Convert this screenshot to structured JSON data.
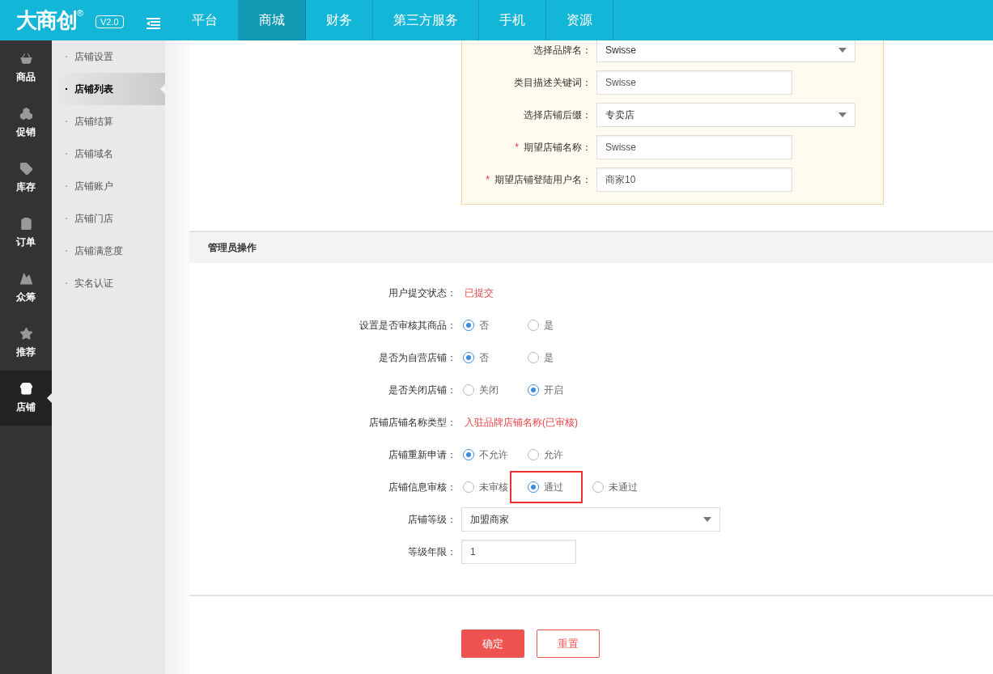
{
  "header": {
    "logo": "大商创",
    "registered": "®",
    "version": "V2.0",
    "nav": [
      {
        "label": "平台",
        "selected": false
      },
      {
        "label": "商城",
        "selected": true
      },
      {
        "label": "财务",
        "selected": false
      },
      {
        "label": "第三方服务",
        "selected": false
      },
      {
        "label": "手机",
        "selected": false
      },
      {
        "label": "资源",
        "selected": false
      }
    ]
  },
  "sidebar": {
    "items": [
      {
        "label": "商品",
        "selected": false
      },
      {
        "label": "促销",
        "selected": false
      },
      {
        "label": "库存",
        "selected": false
      },
      {
        "label": "订单",
        "selected": false
      },
      {
        "label": "众筹",
        "selected": false
      },
      {
        "label": "推荐",
        "selected": false
      },
      {
        "label": "店铺",
        "selected": true
      }
    ]
  },
  "submenu": {
    "items": [
      {
        "label": "店铺设置",
        "selected": false
      },
      {
        "label": "店铺列表",
        "selected": true
      },
      {
        "label": "店铺结算",
        "selected": false
      },
      {
        "label": "店铺域名",
        "selected": false
      },
      {
        "label": "店铺账户",
        "selected": false
      },
      {
        "label": "店铺门店",
        "selected": false
      },
      {
        "label": "店铺满意度",
        "selected": false
      },
      {
        "label": "实名认证",
        "selected": false
      }
    ]
  },
  "brand_form": {
    "fields": [
      {
        "kind": "select",
        "label": "选择品牌名：",
        "value": "Swisse"
      },
      {
        "kind": "input",
        "label": "类目描述关键词：",
        "value": "Swisse"
      },
      {
        "kind": "select",
        "label": "选择店铺后缀：",
        "value": "专卖店"
      },
      {
        "kind": "input",
        "label": "期望店铺名称：",
        "value": "Swisse",
        "mark": "*"
      },
      {
        "kind": "input",
        "label": "期望店铺登陆用户名：",
        "value": "商家10",
        "mark": "*"
      }
    ]
  },
  "admin": {
    "title": "管理员操作",
    "rows": [
      {
        "kind": "text",
        "label": "用户提交状态：",
        "value": "已提交"
      },
      {
        "kind": "radio",
        "label": "设置是否审核其商品：",
        "options": [
          {
            "label": "否",
            "selected": true,
            "highlighted": false
          },
          {
            "label": "是",
            "selected": false,
            "highlighted": false
          }
        ]
      },
      {
        "kind": "radio",
        "label": "是否为自营店铺：",
        "options": [
          {
            "label": "否",
            "selected": true,
            "highlighted": false
          },
          {
            "label": "是",
            "selected": false,
            "highlighted": false
          }
        ]
      },
      {
        "kind": "radio",
        "label": "是否关闭店铺：",
        "options": [
          {
            "label": "关闭",
            "selected": false,
            "highlighted": false
          },
          {
            "label": "开启",
            "selected": true,
            "highlighted": false
          }
        ]
      },
      {
        "kind": "text",
        "label": "店铺店铺名称类型：",
        "value": "入驻品牌店铺名称(已审核)"
      },
      {
        "kind": "radio",
        "label": "店铺重新申请：",
        "options": [
          {
            "label": "不允许",
            "selected": true,
            "highlighted": false
          },
          {
            "label": "允许",
            "selected": false,
            "highlighted": false
          }
        ]
      },
      {
        "kind": "radio",
        "label": "店铺信息审核：",
        "options": [
          {
            "label": "未审核",
            "selected": false,
            "highlighted": false
          },
          {
            "label": "通过",
            "selected": true,
            "highlighted": true
          },
          {
            "label": "未通过",
            "selected": false,
            "highlighted": false
          }
        ]
      },
      {
        "kind": "select",
        "label": "店铺等级：",
        "value": "加盟商家"
      },
      {
        "kind": "input",
        "label": "等级年限：",
        "value": "1"
      }
    ]
  },
  "buttons": [
    {
      "label": "确定",
      "kind": "primary"
    },
    {
      "label": "重置",
      "kind": "secondary"
    }
  ]
}
